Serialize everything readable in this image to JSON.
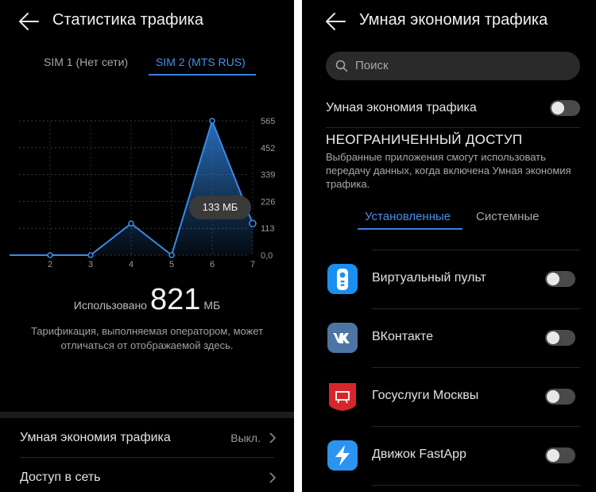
{
  "left": {
    "header": {
      "title": "Статистика трафика"
    },
    "sim_tabs": [
      {
        "label": "SIM 1 (Нет сети)",
        "selected": false
      },
      {
        "label": "SIM 2 (MTS RUS)",
        "selected": true
      }
    ],
    "chart_data": {
      "type": "area",
      "x": [
        1,
        2,
        3,
        4,
        5,
        6,
        7
      ],
      "x_tick_labels": [
        "2",
        "3",
        "4",
        "5",
        "6",
        "7"
      ],
      "y_tick_labels": [
        "565",
        "452",
        "339",
        "226",
        "113",
        "0,0"
      ],
      "ylim": [
        0,
        565
      ],
      "series": [
        {
          "values": [
            0,
            0,
            0,
            133,
            0,
            565,
            133
          ]
        }
      ],
      "highlighted_point": {
        "x": 7,
        "label": "133 МБ"
      },
      "grid": true,
      "color": "#2f7fd8"
    },
    "usage": {
      "label": "Использовано",
      "value": "821",
      "unit": "МБ"
    },
    "note": "Тарификация, выполняемая оператором, может отличаться от отображаемой здесь.",
    "settings": [
      {
        "label": "Умная экономия трафика",
        "value": "Выкл."
      },
      {
        "label": "Доступ в сеть",
        "value": ""
      }
    ]
  },
  "right": {
    "header": {
      "title": "Умная экономия трафика"
    },
    "search": {
      "placeholder": "Поиск"
    },
    "smart_saving": {
      "label": "Умная экономия трафика",
      "enabled": false
    },
    "section": {
      "title": "НЕОГРАНИЧЕННЫЙ ДОСТУП",
      "description": "Выбранные приложения смогут использовать передачу данных, когда включена Умная экономия трафика."
    },
    "app_tabs": [
      {
        "label": "Установленные",
        "selected": true
      },
      {
        "label": "Системные",
        "selected": false
      }
    ],
    "apps": [
      {
        "name": "Виртуальный пульт",
        "icon": "remote-control-icon",
        "enabled": false
      },
      {
        "name": "ВКонтакте",
        "icon": "vk-icon",
        "enabled": false
      },
      {
        "name": "Госуслуги Москвы",
        "icon": "gosuslugi-moscow-icon",
        "enabled": false
      },
      {
        "name": "Движок FastApp",
        "icon": "fastapp-icon",
        "enabled": false
      }
    ]
  },
  "colors": {
    "accent": "#3a7fe0",
    "background": "#000000",
    "toggle_off": "#4a4a4a"
  }
}
